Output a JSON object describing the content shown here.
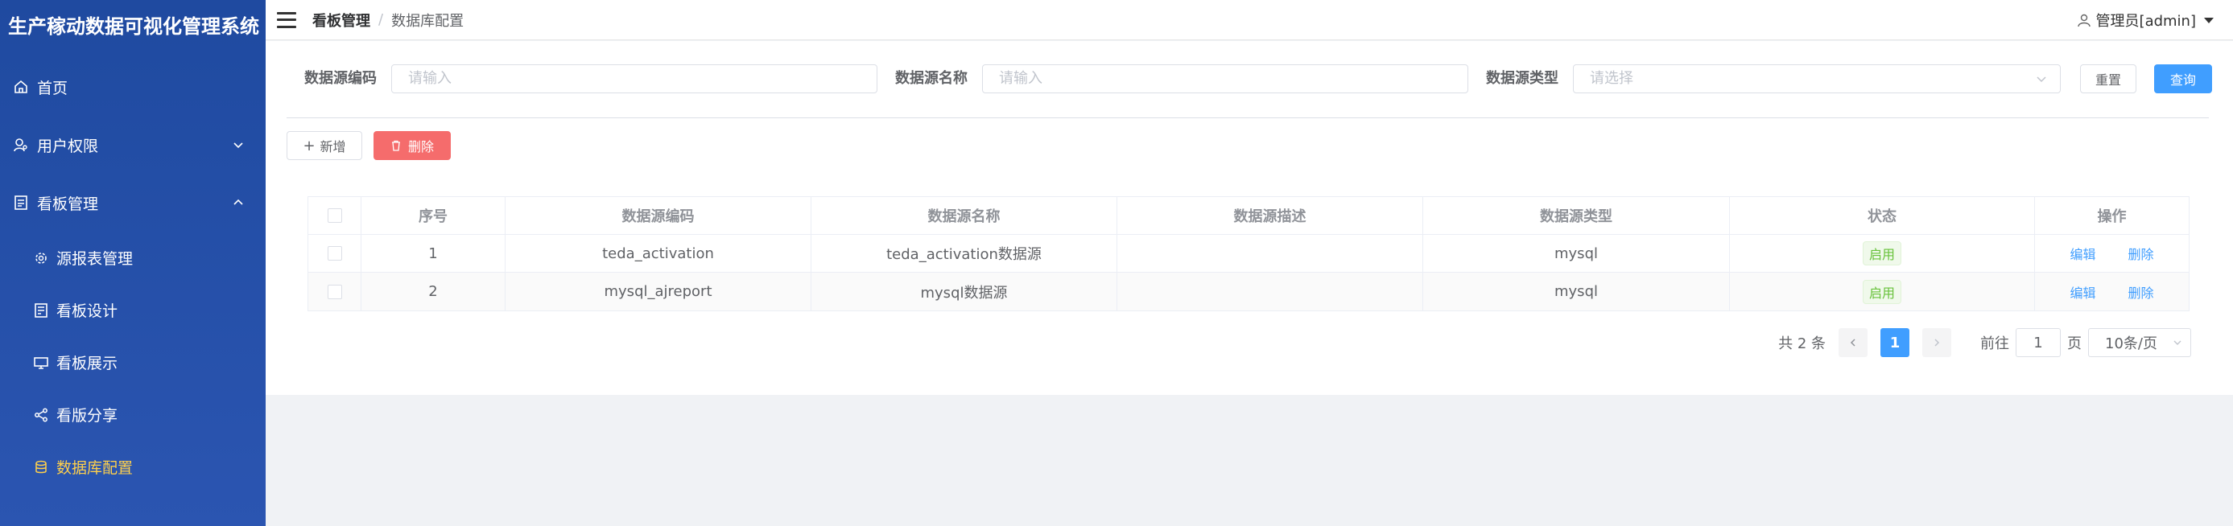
{
  "app": {
    "title": "生产稼动数据可视化管理系统"
  },
  "sidebar": {
    "items": [
      {
        "label": "首页",
        "icon": "home-icon"
      },
      {
        "label": "用户权限",
        "icon": "user-key-icon",
        "expanded": false
      },
      {
        "label": "看板管理",
        "icon": "board-icon",
        "expanded": true
      }
    ],
    "sub_items": [
      {
        "label": "源报表管理",
        "icon": "gear-cluster-icon"
      },
      {
        "label": "看板设计",
        "icon": "design-icon"
      },
      {
        "label": "看板展示",
        "icon": "display-icon"
      },
      {
        "label": "看版分享",
        "icon": "share-icon"
      },
      {
        "label": "数据库配置",
        "icon": "database-icon",
        "active": true
      }
    ]
  },
  "header": {
    "breadcrumb": [
      "看板管理",
      "数据库配置"
    ],
    "separator": "/",
    "user": "管理员[admin]"
  },
  "search": {
    "code_label": "数据源编码",
    "code_placeholder": "请输入",
    "name_label": "数据源名称",
    "name_placeholder": "请输入",
    "type_label": "数据源类型",
    "type_placeholder": "请选择",
    "reset_label": "重置",
    "query_label": "查询"
  },
  "toolbar": {
    "add_label": "新增",
    "delete_label": "删除"
  },
  "table": {
    "columns": [
      "序号",
      "数据源编码",
      "数据源名称",
      "数据源描述",
      "数据源类型",
      "状态",
      "操作"
    ],
    "rows": [
      {
        "index": "1",
        "code": "teda_activation",
        "name": "teda_activation数据源",
        "desc": "",
        "type": "mysql",
        "status": "启用",
        "edit": "编辑",
        "delete": "删除"
      },
      {
        "index": "2",
        "code": "mysql_ajreport",
        "name": "mysql数据源",
        "desc": "",
        "type": "mysql",
        "status": "启用",
        "edit": "编辑",
        "delete": "删除"
      }
    ]
  },
  "pagination": {
    "total_text": "共 2 条",
    "current_page": "1",
    "goto_label": "前往",
    "goto_value": "1",
    "page_suffix": "页",
    "page_size": "10条/页"
  },
  "colors": {
    "sidebar_bg": "#2b55b1",
    "active_menu": "#ffd04b",
    "primary": "#409eff",
    "danger": "#f56c6c",
    "success": "#67c23a"
  }
}
